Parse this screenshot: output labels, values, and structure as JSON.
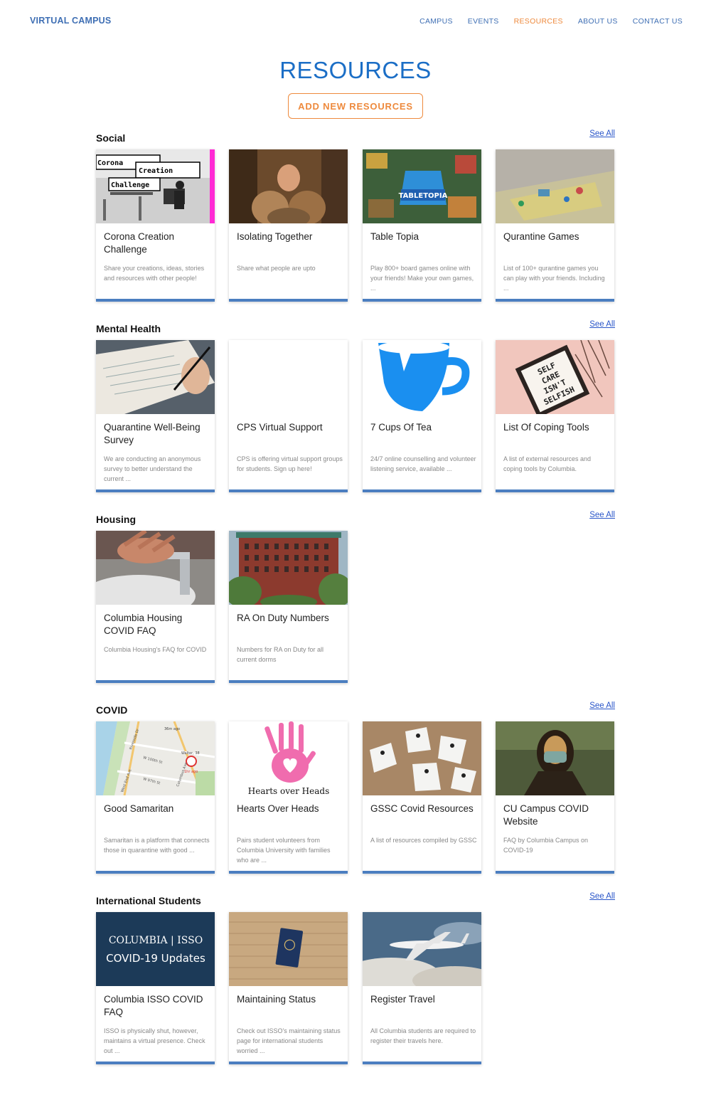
{
  "nav": {
    "brand": "VIRTUAL CAMPUS",
    "links": [
      "CAMPUS",
      "EVENTS",
      "RESOURCES",
      "ABOUT US",
      "CONTACT US"
    ],
    "active": "RESOURCES"
  },
  "page": {
    "title": "RESOURCES",
    "add_button": "ADD NEW RESOURCES"
  },
  "colors": {
    "brand_blue": "#1b6ec6",
    "accent_orange": "#ee8a3d",
    "card_border": "#4b7ec0"
  },
  "sections": [
    {
      "title": "Social",
      "see_all": "See All",
      "cards": [
        {
          "title": "Corona Creation Challenge",
          "desc": "Share your creations, ideas, stories and resources with other people!",
          "image": "corona-creation-image",
          "image_text": [
            "Corona",
            "Creation",
            "Challenge"
          ]
        },
        {
          "title": "Isolating Together",
          "desc": "Share what people are upto",
          "image": "isolating-together-image"
        },
        {
          "title": "Table Topia",
          "desc": "Play 800+ board games online with your friends! Make your own games, ...",
          "image": "tabletopia-image",
          "image_text": [
            "TABLETOPIA"
          ]
        },
        {
          "title": "Qurantine Games",
          "desc": "List of 100+ qurantine games you can play with your friends. Including ...",
          "image": "board-game-image"
        }
      ]
    },
    {
      "title": "Mental Health",
      "see_all": "See All",
      "cards": [
        {
          "title": "Quarantine Well-Being Survey",
          "desc": "We are conducting an anonymous survey to better understand the current ...",
          "image": "writing-image"
        },
        {
          "title": "CPS Virtual Support",
          "desc": "CPS is offering virtual support groups for students. Sign up here!",
          "image": "blank-image"
        },
        {
          "title": "7 Cups Of Tea",
          "desc": "24/7 online counselling and volunteer listening service, available ...",
          "image": "cup-logo-image"
        },
        {
          "title": "List Of Coping Tools",
          "desc": "A list of external resources and coping tools by Columbia.",
          "image": "self-care-image",
          "image_text": [
            "SELF",
            "CARE",
            "ISN'T",
            "SELFISH"
          ]
        }
      ]
    },
    {
      "title": "Housing",
      "see_all": "See All",
      "cards": [
        {
          "title": "Columbia Housing COVID FAQ",
          "desc": "Columbia Housing's FAQ for COVID",
          "image": "handwash-image"
        },
        {
          "title": "RA On Duty Numbers",
          "desc": "Numbers for RA on Duty for all current dorms",
          "image": "dorm-building-image"
        }
      ]
    },
    {
      "title": "COVID",
      "see_all": "See All",
      "cards": [
        {
          "title": "Good Samaritan",
          "desc": "Samaritan is a platform that connects those in quarantine with good ...",
          "image": "map-image",
          "image_text": [
            "36m ago",
            "Walter, 38",
            "1hr ago",
            "W 100th St",
            "W 97th St",
            "Riverside Dr",
            "West End Ave",
            "Columbus Ave"
          ]
        },
        {
          "title": "Hearts Over Heads",
          "desc": "Pairs student volunteers from Columbia University with families who are ...",
          "image": "hand-heart-image",
          "image_text": [
            "Hearts over Heads"
          ]
        },
        {
          "title": "GSSC Covid Resources",
          "desc": "A list of resources compiled by GSSC",
          "image": "paper-people-image"
        },
        {
          "title": "CU Campus COVID Website",
          "desc": "FAQ by Columbia Campus on COVID-19",
          "image": "mona-lisa-mask-image"
        }
      ]
    },
    {
      "title": "International Students",
      "see_all": "See All",
      "cards": [
        {
          "title": "Columbia ISSO COVID FAQ",
          "desc": "ISSO is physically shut, however, maintains a virtual presence. Check out ...",
          "image": "isso-banner-image",
          "image_text": [
            "COLUMBIA | ISSO",
            "COVID-19 Updates"
          ]
        },
        {
          "title": "Maintaining Status",
          "desc": "Check out ISSO's maintaining status page for international students worried ...",
          "image": "passport-image"
        },
        {
          "title": "Register Travel",
          "desc": "All Columbia students are required to register their travels here.",
          "image": "airplane-image"
        }
      ]
    }
  ]
}
